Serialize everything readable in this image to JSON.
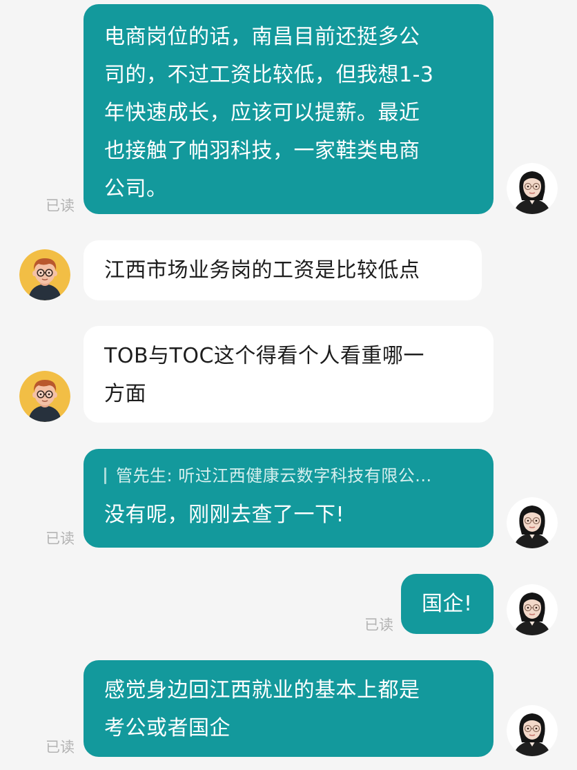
{
  "chat": {
    "read_label": "已读",
    "messages": [
      {
        "side": "out",
        "text": "电商岗位的话，南昌目前还挺多公\n司的，不过工资比较低，但我想1-3\n年快速成长，应该可以提薪。最近\n也接触了帕羽科技，一家鞋类电商\n公司。",
        "read": true
      },
      {
        "side": "in",
        "text": "江西市场业务岗的工资是比较低点"
      },
      {
        "side": "in",
        "text": "TOB与TOC这个得看个人看重哪一\n方面"
      },
      {
        "side": "out",
        "quote": "管先生: 听过江西健康云数字科技有限公...",
        "text": "没有呢，刚刚去查了一下!",
        "read": true
      },
      {
        "side": "out",
        "text": "国企!",
        "read": true
      },
      {
        "side": "out",
        "text": "感觉身边回江西就业的基本上都是\n考公或者国企",
        "read": true
      }
    ]
  },
  "colors": {
    "outgoing_bubble": "#13999c",
    "incoming_bubble": "#ffffff",
    "background": "#f5f5f5",
    "read_label": "#b3b3b3"
  },
  "icons": {
    "self_avatar": "avatar-woman-glasses-icon",
    "peer_avatar": "avatar-man-glasses-cartoon-icon"
  }
}
